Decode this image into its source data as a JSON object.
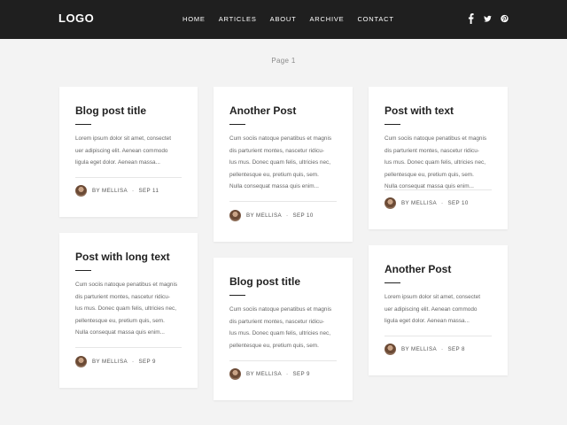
{
  "header": {
    "logo": "LOGO",
    "nav": [
      "HOME",
      "ARTICLES",
      "ABOUT",
      "ARCHIVE",
      "CONTACT"
    ],
    "social": [
      "facebook-icon",
      "twitter-icon",
      "pinterest-icon"
    ]
  },
  "pagination": {
    "label": "Page 1"
  },
  "posts": [
    {
      "title": "Blog post title",
      "excerpt": [
        "Lorem ipsum dolor sit amet, consectet",
        "uer adipiscing elit. Aenean commodo",
        "ligula eget dolor. Aenean massa..."
      ],
      "author": "BY MELLISA",
      "date": "SEP 11"
    },
    {
      "title": "Another Post",
      "excerpt": [
        "Cum sociis natoque penatibus et magnis",
        "dis parturient montes, nascetur ridicu-",
        "lus mus. Donec quam felis, ultricies nec,",
        "pellentesque eu, pretium quis, sem.",
        "Nulla consequat massa quis enim..."
      ],
      "author": "BY MELLISA",
      "date": "SEP 10"
    },
    {
      "title": "Post with text",
      "excerpt": [
        "Cum sociis natoque penatibus et magnis",
        "dis parturient montes, nascetur ridicu-",
        "lus mus. Donec quam felis, ultricies nec,",
        "pellentesque eu, pretium quis, sem.",
        "Nulla consequat massa quis enim..."
      ],
      "author": "BY MELLISA",
      "date": "SEP 10"
    },
    {
      "title": "Post with long text",
      "excerpt": [
        "Cum sociis natoque penatibus et magnis",
        "dis parturient montes, nascetur ridicu-",
        "lus mus. Donec quam felis, ultricies nec,",
        "pellentesque eu, pretium quis, sem.",
        "Nulla consequat massa quis enim..."
      ],
      "author": "BY MELLISA",
      "date": "SEP 9"
    },
    {
      "title": "Blog post title",
      "excerpt": [
        "Cum sociis natoque penatibus et magnis",
        "dis parturient montes, nascetur ridicu-",
        "lus mus. Donec quam felis, ultricies nec,",
        "pellentesque eu, pretium quis, sem."
      ],
      "author": "BY MELLISA",
      "date": "SEP 9"
    },
    {
      "title": "Another Post",
      "excerpt": [
        "Lorem ipsum dolor sit amet, consectet",
        "uer adipiscing elit. Aenean commodo",
        "ligula eget dolor. Aenean massa..."
      ],
      "author": "BY MELLISA",
      "date": "SEP 8"
    }
  ]
}
